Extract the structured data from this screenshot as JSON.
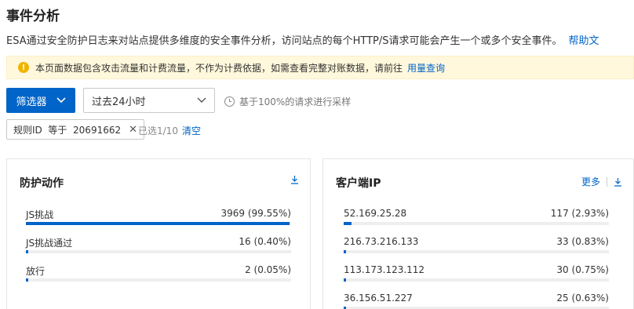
{
  "header": {
    "title": "事件分析",
    "description": "ESA通过安全防护日志来对站点提供多维度的安全事件分析，访问站点的每个HTTP/S请求可能会产生一个或多个安全事件。",
    "help_link": "帮助文"
  },
  "notice": {
    "text": "本页面数据包含攻击流量和计费流量，不作为计费依据，如需查看完整对账数据，请前往",
    "link": "用量查询",
    "icon": "warning-icon",
    "color": "#f0b400"
  },
  "toolbar": {
    "filter_label": "筛选器",
    "time_range": "过去24小时",
    "sample_note": "基于100%的请求进行采样",
    "accent_color": "#0064c8"
  },
  "filters": {
    "tag_text": "规则ID  等于  20691662",
    "selected_count": "已选1/10",
    "clear_label": "清空"
  },
  "panels": {
    "actions": {
      "title": "防护动作",
      "rows": [
        {
          "label": "JS挑战",
          "value": "3969 (99.55%)",
          "fraction": 0.9955
        },
        {
          "label": "JS挑战通过",
          "value": "16 (0.40%)",
          "fraction": 0.004
        },
        {
          "label": "放行",
          "value": "2 (0.05%)",
          "fraction": 0.0005
        }
      ]
    },
    "client_ip": {
      "title": "客户端IP",
      "more_label": "更多",
      "rows": [
        {
          "label": "52.169.25.28",
          "value": "117 (2.93%)",
          "fraction": 0.0293
        },
        {
          "label": "216.73.216.133",
          "value": "33 (0.83%)",
          "fraction": 0.0083
        },
        {
          "label": "113.173.123.112",
          "value": "30 (0.75%)",
          "fraction": 0.0075
        },
        {
          "label": "36.156.51.227",
          "value": "25 (0.63%)",
          "fraction": 0.0063
        }
      ]
    }
  }
}
